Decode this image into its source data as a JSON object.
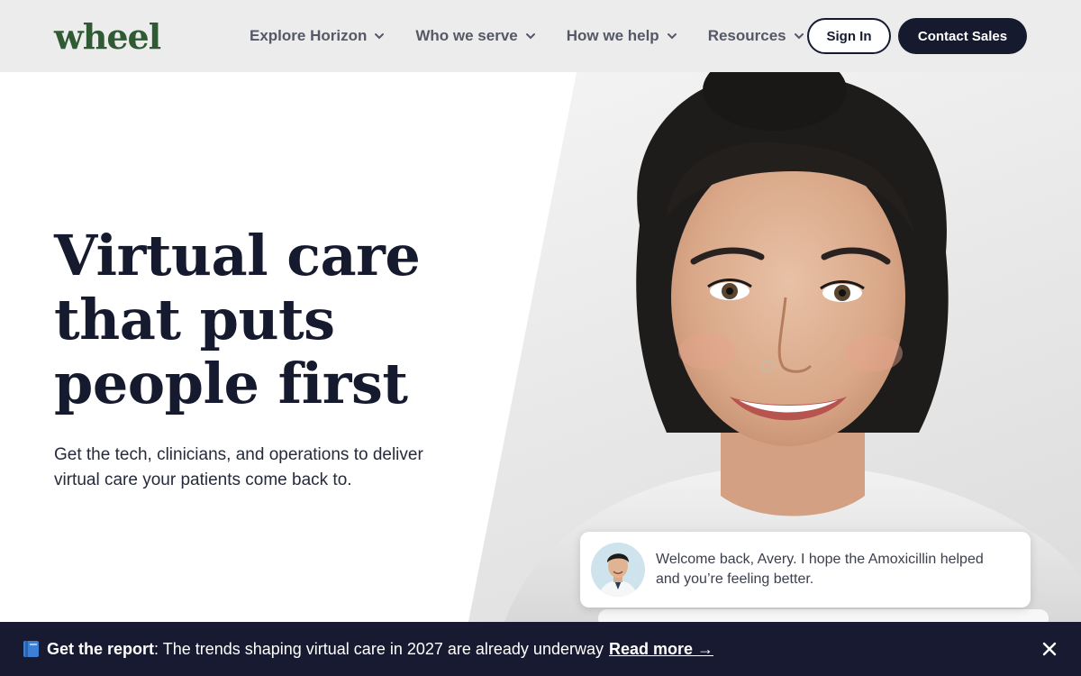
{
  "header": {
    "logo": "wheel",
    "nav": [
      {
        "label": "Explore Horizon"
      },
      {
        "label": "Who we serve"
      },
      {
        "label": "How we help"
      },
      {
        "label": "Resources"
      }
    ],
    "sign_in": "Sign In",
    "contact_sales": "Contact Sales"
  },
  "hero": {
    "title_line1": "Virtual care",
    "title_line2": "that puts",
    "title_line3": "people first",
    "subtitle": "Get the tech, clinicians, and operations to deliver virtual care your patients come back to."
  },
  "chat": {
    "message": "Welcome back, Avery. I hope the Amoxicillin helped and you’re feeling better."
  },
  "banner": {
    "bold": "Get the report",
    "text": ": The trends shaping virtual care in 2027 are already underway",
    "link": "Read more →"
  },
  "colors": {
    "brand_green": "#2f5a34",
    "navy": "#161a2e",
    "banner_bg": "#181a31",
    "header_bg": "#ececec"
  },
  "icons": {
    "nav_chevron": "chevron-down-icon",
    "banner_book": "book-icon",
    "banner_close": "close-icon"
  }
}
